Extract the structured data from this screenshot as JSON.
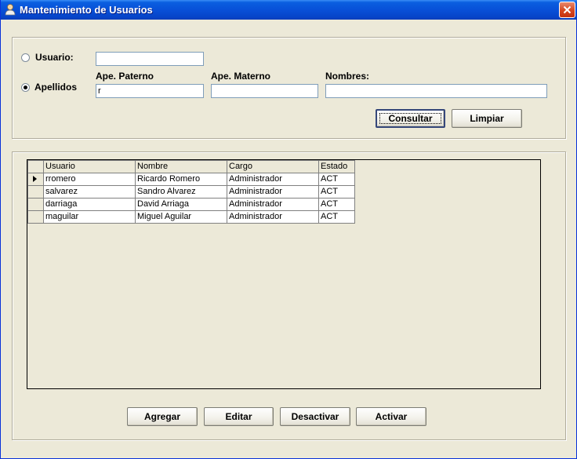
{
  "window": {
    "title": "Mantenimiento de Usuarios"
  },
  "search": {
    "options": [
      {
        "label": "Usuario:",
        "checked": false
      },
      {
        "label": "Apellidos",
        "checked": true
      }
    ],
    "usuario_value": "",
    "ape_paterno_label": "Ape. Paterno",
    "ape_paterno_value": "r",
    "ape_materno_label": "Ape. Materno",
    "ape_materno_value": "",
    "nombres_label": "Nombres:",
    "nombres_value": "",
    "consultar_label": "Consultar",
    "limpiar_label": "Limpiar"
  },
  "grid": {
    "columns": [
      "Usuario",
      "Nombre",
      "Cargo",
      "Estado"
    ],
    "current_row": 0,
    "rows": [
      [
        "rromero",
        "Ricardo Romero",
        "Administrador",
        "ACT"
      ],
      [
        "salvarez",
        "Sandro Alvarez",
        "Administrador",
        "ACT"
      ],
      [
        "darriaga",
        "David Arriaga",
        "Administrador",
        "ACT"
      ],
      [
        "maguilar",
        "Miguel Aguilar",
        "Administrador",
        "ACT"
      ]
    ]
  },
  "actions": {
    "agregar_label": "Agregar",
    "editar_label": "Editar",
    "desactivar_label": "Desactivar",
    "activar_label": "Activar"
  },
  "colors": {
    "titlebar": "#0A5FE0",
    "window_bg": "#ECE9D8",
    "close": "#D6461E"
  }
}
